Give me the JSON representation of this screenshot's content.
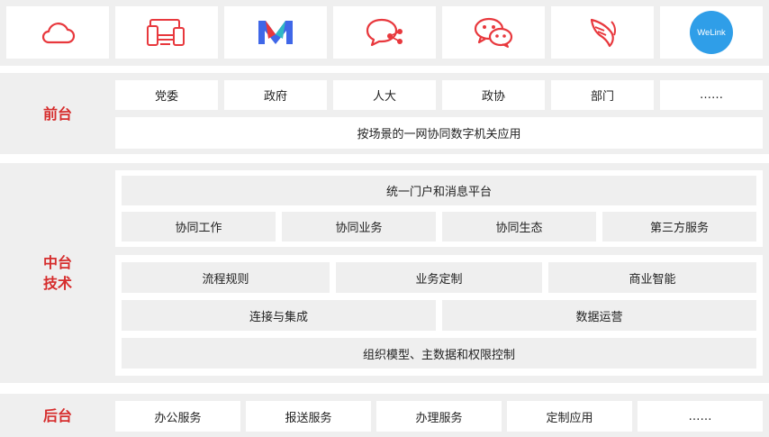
{
  "colors": {
    "accent": "#e8383d",
    "brand_blue": "#3f67e8",
    "welink": "#2f9ee8",
    "band": "#efefef"
  },
  "icons": [
    "cloud-icon",
    "devices-icon",
    "m-logo-icon",
    "chat-share-icon",
    "wechat-icon",
    "angel-wing-icon",
    "welink-logo-icon"
  ],
  "welink_text": "WeLink",
  "front": {
    "label": "前台",
    "items": [
      "党委",
      "政府",
      "人大",
      "政协",
      "部门",
      "……"
    ],
    "wide": "按场景的一网协同数字机关应用"
  },
  "middle": {
    "label_line1": "中台",
    "label_line2": "技术",
    "portal": "统一门户和消息平台",
    "collab": [
      "协同工作",
      "协同业务",
      "协同生态",
      "第三方服务"
    ],
    "row1": [
      "流程规则",
      "业务定制",
      "商业智能"
    ],
    "row2": [
      "连接与集成",
      "数据运营"
    ],
    "row3": "组织模型、主数据和权限控制"
  },
  "back": {
    "label": "后台",
    "items": [
      "办公服务",
      "报送服务",
      "办理服务",
      "定制应用",
      "……"
    ]
  }
}
